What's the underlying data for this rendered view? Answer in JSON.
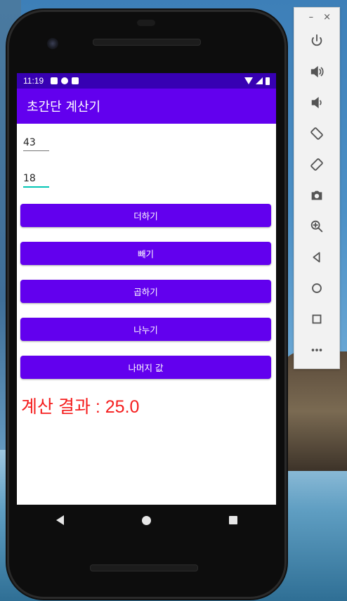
{
  "status_bar": {
    "time": "11:19"
  },
  "app": {
    "title": "초간단 계산기"
  },
  "inputs": {
    "first_value": "43",
    "second_value": "18"
  },
  "buttons": {
    "add": "더하기",
    "subtract": "빼기",
    "multiply": "곱하기",
    "divide": "나누기",
    "remainder": "나머지 값"
  },
  "result": {
    "text": "계산 결과 : 25.0"
  },
  "emulator_panel": {
    "window_controls": {
      "minimize": "–",
      "close": "×"
    },
    "tools": [
      "power-icon",
      "volume-up-icon",
      "volume-down-icon",
      "rotate-left-icon",
      "rotate-right-icon",
      "camera-icon",
      "zoom-icon",
      "back-icon",
      "home-icon",
      "overview-icon",
      "more-icon"
    ]
  },
  "colors": {
    "status_bar": "#3700b3",
    "app_bar": "#6200ee",
    "button": "#6200ee",
    "result_text": "#f51d1d",
    "focused_underline": "#03c5b4"
  }
}
